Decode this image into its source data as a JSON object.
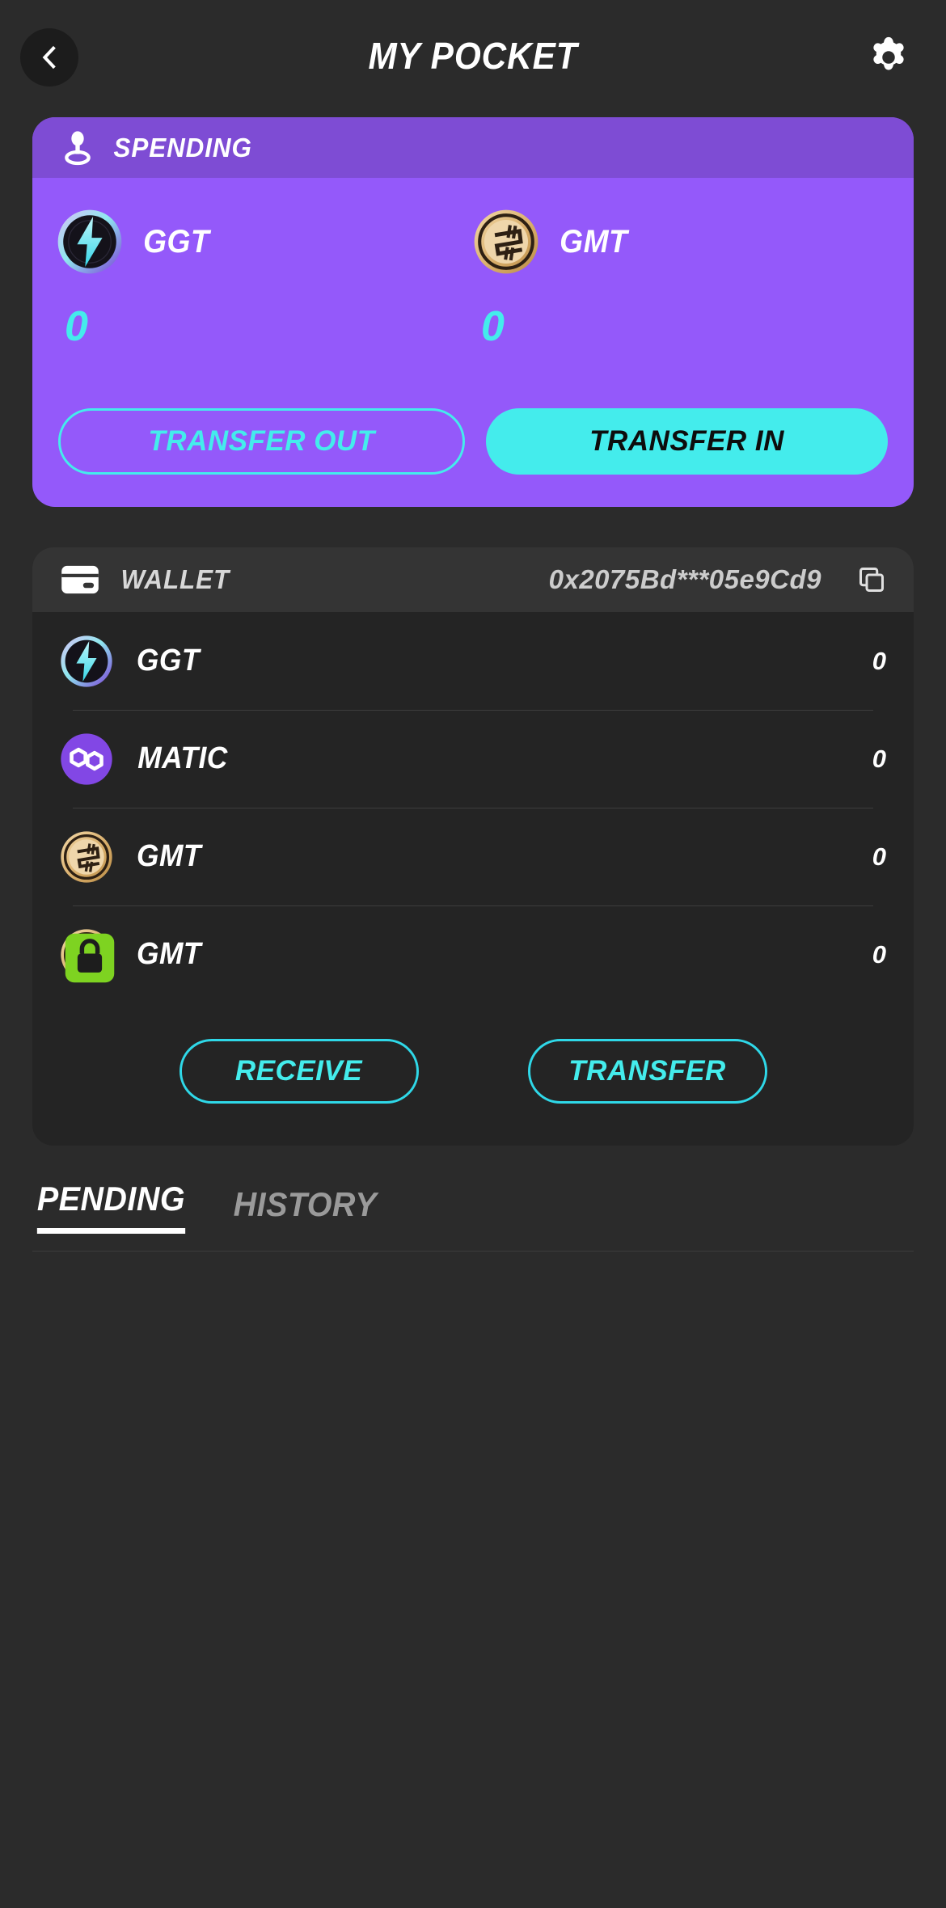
{
  "header": {
    "title": "MY POCKET",
    "back_icon": "chevron-left-icon",
    "settings_icon": "gear-icon"
  },
  "spending": {
    "icon": "joystick-pin-icon",
    "label": "SPENDING",
    "tokens": [
      {
        "symbol": "GGT",
        "icon": "ggt-coin-icon",
        "balance": "0"
      },
      {
        "symbol": "GMT",
        "icon": "gmt-coin-icon",
        "balance": "0"
      }
    ],
    "transfer_out_label": "TRANSFER OUT",
    "transfer_in_label": "TRANSFER IN"
  },
  "wallet": {
    "icon": "wallet-card-icon",
    "label": "WALLET",
    "address": "0x2075Bd***05e9Cd9",
    "copy_icon": "copy-icon",
    "rows": [
      {
        "symbol": "GGT",
        "icon": "ggt-coin-icon",
        "balance": "0",
        "locked": false
      },
      {
        "symbol": "MATIC",
        "icon": "matic-coin-icon",
        "balance": "0",
        "locked": false
      },
      {
        "symbol": "GMT",
        "icon": "gmt-coin-icon",
        "balance": "0",
        "locked": false
      },
      {
        "symbol": "GMT",
        "icon": "gmt-coin-icon",
        "balance": "0",
        "locked": true
      }
    ],
    "receive_label": "RECEIVE",
    "transfer_label": "TRANSFER"
  },
  "tabs": {
    "pending_label": "PENDING",
    "history_label": "HISTORY",
    "active": "PENDING"
  },
  "colors": {
    "background": "#2b2b2b",
    "spending_card": "#9459fa",
    "spending_header": "#7e4cd4",
    "accent_cyan": "#44ecec",
    "wallet_card": "#242424",
    "wallet_header": "#343434"
  }
}
